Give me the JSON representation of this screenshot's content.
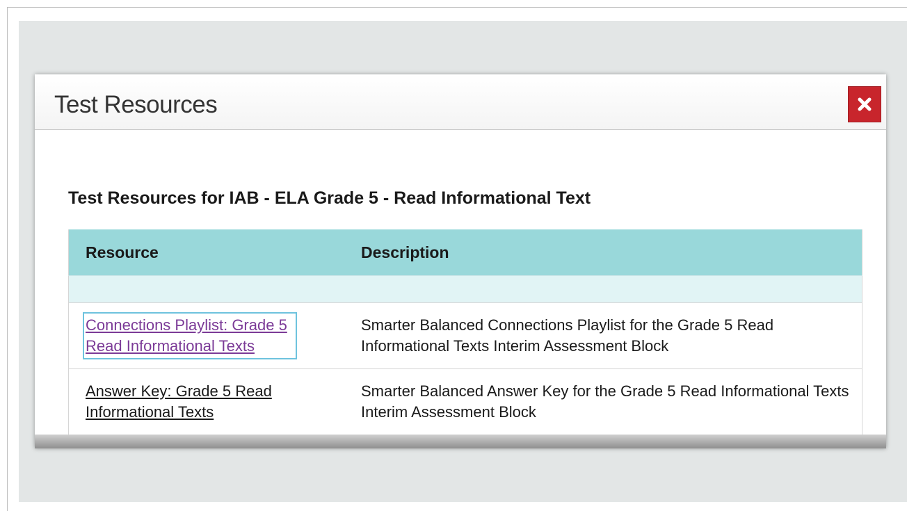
{
  "modal": {
    "title": "Test Resources",
    "close_icon": "close-x-icon",
    "accent_color": "#c8252c"
  },
  "section": {
    "heading": "Test Resources for IAB - ELA Grade 5 - Read Informational Text"
  },
  "table": {
    "header_color": "#99d8da",
    "columns": [
      "Resource",
      "Description"
    ],
    "rows": [
      {
        "resource": "Connections Playlist: Grade 5 Read Informational Texts",
        "description": "Smarter Balanced Connections Playlist for the Grade 5 Read Informational Texts Interim Assessment Block",
        "link_color": "#7b3a97"
      },
      {
        "resource": "Answer Key: Grade 5 Read Informational Texts",
        "description": "Smarter Balanced Answer Key for the Grade 5 Read Informational Texts Interim Assessment Block",
        "link_color": "#1a1a1a"
      }
    ]
  }
}
